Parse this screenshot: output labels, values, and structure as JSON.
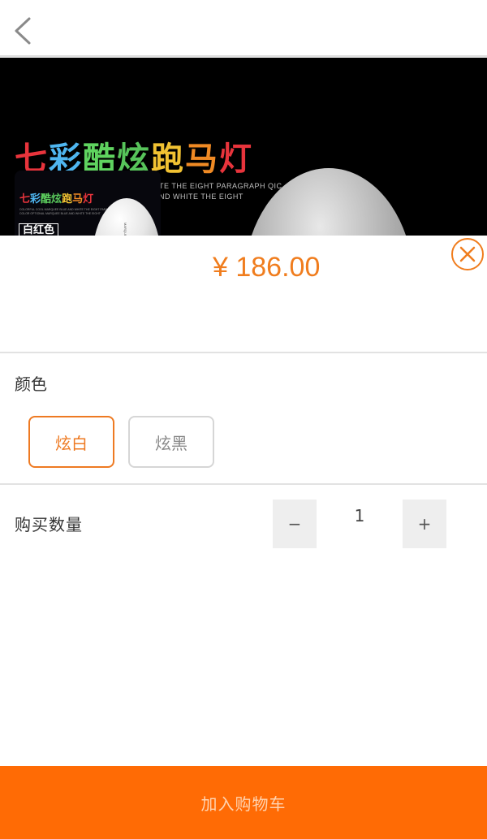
{
  "nav": {
    "back_icon": "chevron-left-icon"
  },
  "banner": {
    "title_chars": [
      "七",
      "彩",
      "酷",
      "炫",
      "跑",
      "马",
      "灯"
    ],
    "title_colors": [
      "#e8343c",
      "#4fb6f0",
      "#5fd35f",
      "#57c45a",
      "#f1c232",
      "#f08a24",
      "#e8343c"
    ],
    "subtitle_line1": "TE THE EIGHT PARAGRAPH QIC",
    "subtitle_line2": "ND WHITE THE EIGHT"
  },
  "product": {
    "thumb_title_chars": [
      "七",
      "彩",
      "酷",
      "炫",
      "跑",
      "马",
      "灯"
    ],
    "thumb_title_colors": [
      "#e8343c",
      "#4fb6f0",
      "#5fd35f",
      "#57c45a",
      "#f1c232",
      "#f08a24",
      "#e8343c"
    ],
    "thumb_tiny_text": "COLORFUL COOL MARQUEE BLUE AND WHITE THE EIGHT PARAGRAPH QIC RED COLOR OPTIONAL MARQUEE BLUE AND WHITE THE EIGHT",
    "thumb_badge": "白红色",
    "thumb_egg_text": "MARQUEE",
    "price": "¥ 186.00",
    "close_icon": "close-circle-icon",
    "accent_color": "#f07d1e"
  },
  "options": {
    "color_label": "颜色",
    "colors": [
      {
        "label": "炫白",
        "selected": true
      },
      {
        "label": "炫黑",
        "selected": false
      }
    ]
  },
  "quantity": {
    "label": "购买数量",
    "minus": "−",
    "value": "1",
    "plus": "+"
  },
  "cart": {
    "button_label": "加入购物车",
    "button_color": "#ff6b05"
  }
}
